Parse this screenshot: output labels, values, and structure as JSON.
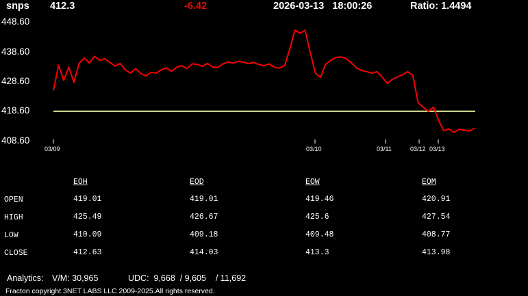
{
  "header": {
    "symbol": "snps",
    "price": "412.3",
    "change": "-6.42",
    "datetime": "2026-03-13   18:00:26",
    "ratio": "Ratio: 1.4494"
  },
  "colors": {
    "line": "#ff0000",
    "reference": "#e8f0a0",
    "negative": "#e01010",
    "background": "#000000"
  },
  "chart_data": {
    "type": "line",
    "title": "",
    "y_ticks": [
      "448.60",
      "438.60",
      "428.60",
      "418.60",
      "408.60"
    ],
    "ylim": [
      408.6,
      448.6
    ],
    "x_ticks": [
      "03/09",
      "03/10",
      "03/11",
      "03/12",
      "03/13"
    ],
    "reference_value": 418.6,
    "series": [
      {
        "values": [
          425.6,
          434.2,
          429.1,
          433.5,
          428.4,
          434.8,
          436.6,
          434.9,
          437.2,
          435.8,
          436.4,
          435.1,
          433.9,
          434.8,
          432.6,
          431.5,
          433.0,
          431.4,
          430.5,
          431.8,
          431.5,
          432.6,
          433.2,
          432.1,
          433.5,
          434.0,
          433.0,
          434.6,
          434.5,
          433.8,
          434.8,
          433.6,
          433.4,
          434.6,
          435.2,
          434.9,
          435.5,
          435.2,
          434.7,
          435.1,
          434.4,
          434.0,
          434.6,
          433.5,
          433.2,
          434.0,
          439.5,
          446.0,
          445.0,
          446.0,
          438.5,
          431.5,
          430.0,
          434.5,
          435.8,
          436.8,
          437.0,
          436.4,
          435.0,
          433.3,
          432.4,
          432.0,
          431.5,
          432.0,
          430.2,
          428.0,
          429.4,
          430.2,
          431.0,
          432.0,
          430.6,
          421.5,
          420.0,
          418.6,
          420.0,
          415.5,
          412.0,
          412.6,
          411.5,
          412.5,
          412.2,
          411.9,
          412.8
        ]
      }
    ]
  },
  "stats": {
    "columns": [
      "EOH",
      "EOD",
      "EOW",
      "EOM"
    ],
    "rows": [
      {
        "label": "OPEN",
        "values": [
          "419.01",
          "419.01",
          "419.46",
          "420.91"
        ]
      },
      {
        "label": "HIGH",
        "values": [
          "425.49",
          "426.67",
          "425.6",
          "427.54"
        ]
      },
      {
        "label": "LOW",
        "values": [
          "410.09",
          "409.18",
          "409.48",
          "408.77"
        ]
      },
      {
        "label": "CLOSE",
        "values": [
          "412.63",
          "414.03",
          "413.3",
          "413.98"
        ]
      }
    ]
  },
  "footer": {
    "analytics_label": "Analytics:",
    "vm_text": "V/M: 30,965",
    "udc_text": "UDC:  9,668  / 9,605    / 11,692",
    "copyright": "Fracton copyright 3NET LABS LLC 2009-2025.All rights reserved."
  }
}
